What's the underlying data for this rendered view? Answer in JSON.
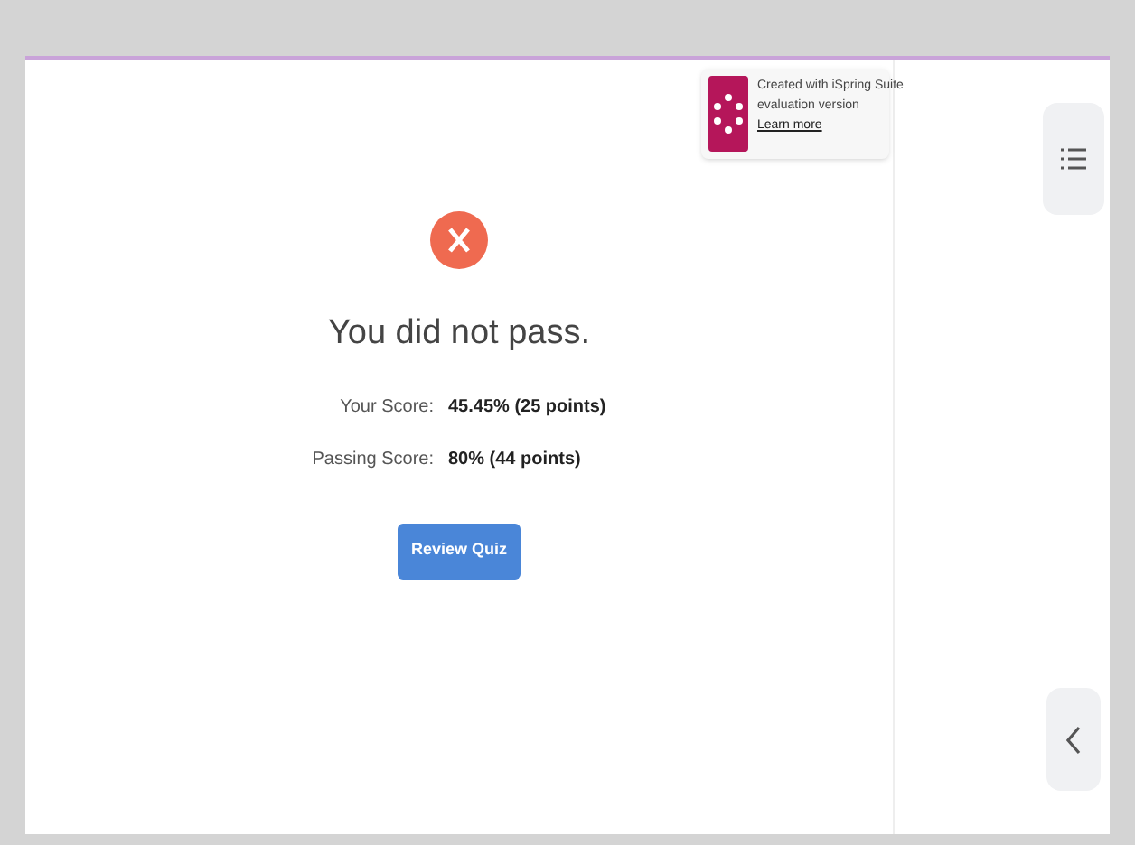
{
  "badge": {
    "line_1": "Created with iSpring Suite",
    "line_2": "evaluation version",
    "link": "Learn more"
  },
  "result": {
    "passed": false,
    "title": "You did not pass."
  },
  "scores": [
    {
      "label": "Your Score:",
      "value": "45.45% (25 points)"
    },
    {
      "label": "Passing Score:",
      "value": "80% (44 points)"
    }
  ],
  "review_button": "Review Quiz"
}
